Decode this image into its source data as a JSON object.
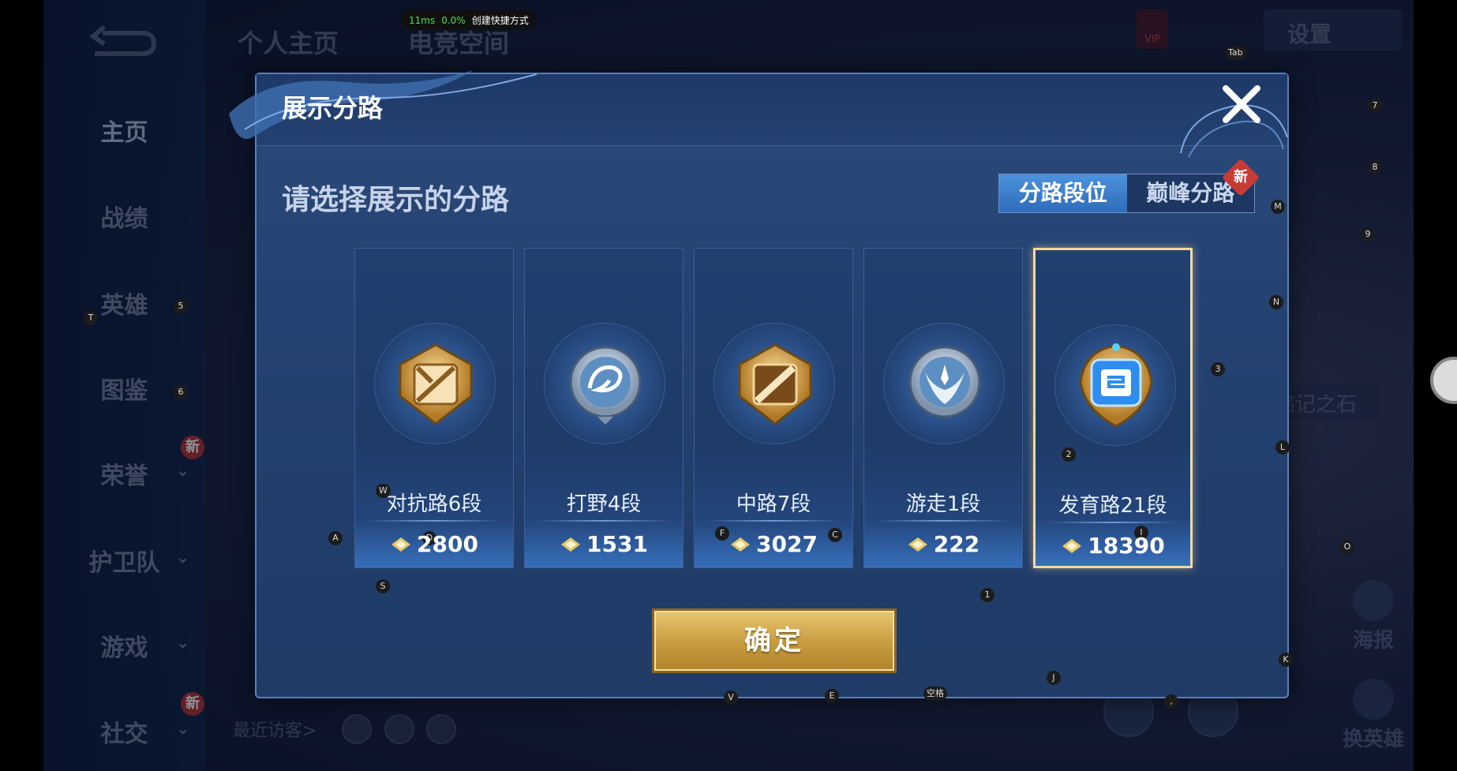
{
  "perf": {
    "latency": "11ms",
    "cpu": "0.0%",
    "shortcut": "创建快捷方式"
  },
  "background": {
    "top_tabs": [
      "个人主页",
      "电竞空间"
    ],
    "settings": "设置",
    "vip": "VIP",
    "sidebar": [
      {
        "label": "主页",
        "active": true
      },
      {
        "label": "战绩"
      },
      {
        "label": "英雄"
      },
      {
        "label": "图鉴"
      },
      {
        "label": "荣誉",
        "badge": "新"
      },
      {
        "label": "护卫队"
      },
      {
        "label": "游戏"
      },
      {
        "label": "社交",
        "badge": "新"
      }
    ],
    "visitors": "最近访客>",
    "stone": "铭记之石",
    "poster": "海报",
    "switch_hero": "换英雄"
  },
  "dialog": {
    "title": "展示分路",
    "prompt": "请选择展示的分路",
    "tabs": [
      {
        "label": "分路段位",
        "active": true
      },
      {
        "label": "巅峰分路",
        "badge": "新"
      }
    ],
    "cards": [
      {
        "name": "对抗路6段",
        "score": "2800",
        "emblem": "clash-lane-gold-emblem",
        "selected": false
      },
      {
        "name": "打野4段",
        "score": "1531",
        "emblem": "jungle-silver-dragon-emblem",
        "selected": false
      },
      {
        "name": "中路7段",
        "score": "3027",
        "emblem": "mid-lane-gold-emblem",
        "selected": false
      },
      {
        "name": "游走1段",
        "score": "222",
        "emblem": "roam-silver-wing-emblem",
        "selected": false
      },
      {
        "name": "发育路21段",
        "score": "18390",
        "emblem": "farm-lane-gold-blue-emblem",
        "selected": true
      }
    ],
    "confirm": "确定"
  },
  "key_hints": [
    "Tab",
    "7",
    "8",
    "M",
    "9",
    "N",
    "3",
    "T",
    "5",
    "6",
    "L",
    "2",
    "W",
    "A",
    "D",
    "F",
    "C",
    "I",
    "O",
    "S",
    "1",
    "K",
    "J",
    "V",
    "E",
    "空格",
    ",",
    "2"
  ],
  "colors": {
    "accent_blue": "#2e6cba",
    "gold": "#c79b3f",
    "selected_border": "#f2d9a0",
    "badge_red": "#c73b36"
  }
}
